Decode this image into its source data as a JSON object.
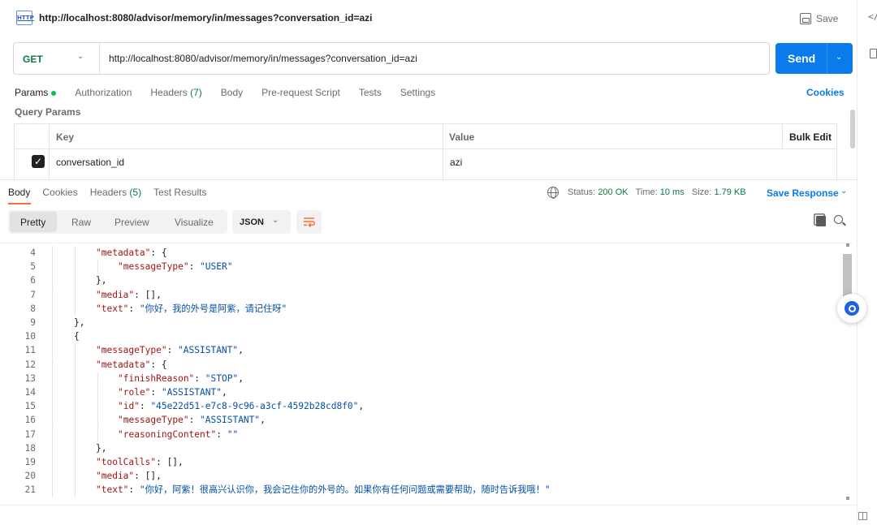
{
  "header": {
    "badge": "HTTP",
    "title_url": "http://localhost:8080/advisor/memory/in/messages?conversation_id=azi",
    "save_label": "Save"
  },
  "rail": {
    "code_icon_glyph": "</"
  },
  "request": {
    "method": "GET",
    "url": "http://localhost:8080/advisor/memory/in/messages?conversation_id=azi",
    "send_label": "Send"
  },
  "request_tabs": {
    "params": "Params",
    "authorization": "Authorization",
    "headers": "Headers",
    "headers_count": "(7)",
    "body": "Body",
    "prerequest": "Pre-request Script",
    "tests": "Tests",
    "settings": "Settings",
    "cookies": "Cookies"
  },
  "query_params": {
    "title": "Query Params",
    "headers": {
      "key": "Key",
      "value": "Value",
      "bulk_edit": "Bulk Edit"
    },
    "rows": [
      {
        "checked": true,
        "key": "conversation_id",
        "value": "azi"
      }
    ]
  },
  "response_tabs": {
    "body": "Body",
    "cookies": "Cookies",
    "headers": "Headers",
    "headers_count": "(5)",
    "test_results": "Test Results"
  },
  "response_meta": {
    "status_label": "Status:",
    "status_value": "200 OK",
    "time_label": "Time:",
    "time_value": "10 ms",
    "size_label": "Size:",
    "size_value": "1.79 KB",
    "save_response": "Save Response"
  },
  "format": {
    "pretty": "Pretty",
    "raw": "Raw",
    "preview": "Preview",
    "visualize": "Visualize",
    "language": "JSON"
  },
  "colors": {
    "accent": "#097bed",
    "method": "#0c7a43",
    "active_tab_underline": "#ff6c37"
  },
  "code_lines": [
    {
      "n": "4",
      "indent": 2,
      "parts": [
        [
          "k",
          "\"metadata\""
        ],
        [
          "p",
          ": {"
        ]
      ]
    },
    {
      "n": "5",
      "indent": 3,
      "parts": [
        [
          "k",
          "\"messageType\""
        ],
        [
          "p",
          ": "
        ],
        [
          "s",
          "\"USER\""
        ]
      ]
    },
    {
      "n": "6",
      "indent": 2,
      "parts": [
        [
          "p",
          "},"
        ]
      ]
    },
    {
      "n": "7",
      "indent": 2,
      "parts": [
        [
          "k",
          "\"media\""
        ],
        [
          "p",
          ": [],"
        ]
      ]
    },
    {
      "n": "8",
      "indent": 2,
      "parts": [
        [
          "k",
          "\"text\""
        ],
        [
          "p",
          ": "
        ],
        [
          "s",
          "\"你好，我的外号是阿紫，请记住呀\""
        ]
      ]
    },
    {
      "n": "9",
      "indent": 1,
      "parts": [
        [
          "p",
          "},"
        ]
      ]
    },
    {
      "n": "10",
      "indent": 1,
      "parts": [
        [
          "p",
          "{"
        ]
      ]
    },
    {
      "n": "11",
      "indent": 2,
      "parts": [
        [
          "k",
          "\"messageType\""
        ],
        [
          "p",
          ": "
        ],
        [
          "s",
          "\"ASSISTANT\""
        ],
        [
          "p",
          ","
        ]
      ]
    },
    {
      "n": "12",
      "indent": 2,
      "parts": [
        [
          "k",
          "\"metadata\""
        ],
        [
          "p",
          ": {"
        ]
      ]
    },
    {
      "n": "13",
      "indent": 3,
      "parts": [
        [
          "k",
          "\"finishReason\""
        ],
        [
          "p",
          ": "
        ],
        [
          "s",
          "\"STOP\""
        ],
        [
          "p",
          ","
        ]
      ]
    },
    {
      "n": "14",
      "indent": 3,
      "parts": [
        [
          "k",
          "\"role\""
        ],
        [
          "p",
          ": "
        ],
        [
          "s",
          "\"ASSISTANT\""
        ],
        [
          "p",
          ","
        ]
      ]
    },
    {
      "n": "15",
      "indent": 3,
      "parts": [
        [
          "k",
          "\"id\""
        ],
        [
          "p",
          ": "
        ],
        [
          "s",
          "\"45e22d51-e7c8-9c96-a3cf-4592b28cd8f0\""
        ],
        [
          "p",
          ","
        ]
      ]
    },
    {
      "n": "16",
      "indent": 3,
      "parts": [
        [
          "k",
          "\"messageType\""
        ],
        [
          "p",
          ": "
        ],
        [
          "s",
          "\"ASSISTANT\""
        ],
        [
          "p",
          ","
        ]
      ]
    },
    {
      "n": "17",
      "indent": 3,
      "parts": [
        [
          "k",
          "\"reasoningContent\""
        ],
        [
          "p",
          ": "
        ],
        [
          "s",
          "\"\""
        ]
      ]
    },
    {
      "n": "18",
      "indent": 2,
      "parts": [
        [
          "p",
          "},"
        ]
      ]
    },
    {
      "n": "19",
      "indent": 2,
      "parts": [
        [
          "k",
          "\"toolCalls\""
        ],
        [
          "p",
          ": [],"
        ]
      ]
    },
    {
      "n": "20",
      "indent": 2,
      "parts": [
        [
          "k",
          "\"media\""
        ],
        [
          "p",
          ": [],"
        ]
      ]
    },
    {
      "n": "21",
      "indent": 2,
      "parts": [
        [
          "k",
          "\"text\""
        ],
        [
          "p",
          ": "
        ],
        [
          "s",
          "\"你好，阿紫！很高兴认识你，我会记住你的外号的。如果你有任何问题或需要帮助，随时告诉我哦！\""
        ]
      ]
    }
  ]
}
